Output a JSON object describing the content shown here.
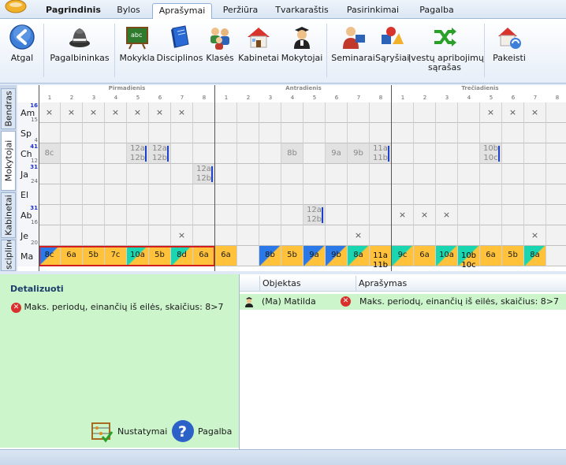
{
  "menu": {
    "tabs": [
      "Pagrindinis",
      "Bylos",
      "Aprašymai",
      "Peržiūra",
      "Tvarkaraštis",
      "Pasirinkimai",
      "Pagalba"
    ],
    "active_tab": "Aprašymai"
  },
  "ribbon": {
    "back": "Atgal",
    "pagalbininkas": "Pagalbininkas",
    "mokykla": "Mokykla",
    "disciplinos": "Disciplinos",
    "klases": "Klasės",
    "kabinetai": "Kabinetai",
    "mokytojai": "Mokytojai",
    "seminarai": "Seminarai",
    "sarysiai": "Sąryšiai",
    "apribojimai_1": "Įvestų apribojimų",
    "apribojimai_2": "sąrašas",
    "pakeisti": "Pakeisti"
  },
  "side_tabs": [
    "Bendras",
    "Mokytojai",
    "Kabinetai",
    "Disciplinos"
  ],
  "grid": {
    "days": [
      "Pirmadienis",
      "Antradienis",
      "Trečiadienis"
    ],
    "periods": [
      "1",
      "2",
      "3",
      "4",
      "5",
      "6",
      "7",
      "8"
    ],
    "rows": [
      {
        "abbr": "Am",
        "n1": "16",
        "n2": "15"
      },
      {
        "abbr": "Sp",
        "n1": "",
        "n2": "4"
      },
      {
        "abbr": "Ch",
        "n1": "41",
        "n2": "12"
      },
      {
        "abbr": "Ja",
        "n1": "31",
        "n2": "24"
      },
      {
        "abbr": "El",
        "n1": "",
        "n2": ""
      },
      {
        "abbr": "Ab",
        "n1": "31",
        "n2": "16"
      },
      {
        "abbr": "Je",
        "n1": "",
        "n2": "20"
      },
      {
        "abbr": "Ma",
        "n1": "",
        "n2": ""
      }
    ],
    "ch_cells": [
      {
        "line1": "8c",
        "line2": ""
      },
      {
        "line1": "12a",
        "line2": "12b"
      },
      {
        "line1": "12a",
        "line2": "12b"
      },
      {
        "line1": "8b",
        "line2": ""
      },
      {
        "line1": "9a",
        "line2": ""
      },
      {
        "line1": "9b",
        "line2": ""
      },
      {
        "line1": "11a",
        "line2": "11b"
      },
      {
        "line1": "10b",
        "line2": "10c"
      }
    ],
    "ja_cell": {
      "line1": "12a",
      "line2": "12b"
    },
    "ab_cell": {
      "line1": "12a",
      "line2": "12b"
    },
    "ma_lessons": [
      "8c",
      "6a",
      "5b",
      "7c",
      "10a",
      "5b",
      "8d",
      "6a",
      "6a",
      "8b",
      "5b",
      "9a",
      "9b",
      "8a",
      "11a",
      "11b",
      "9c",
      "6a",
      "10a",
      "10b",
      "10c",
      "6a",
      "5b",
      "8a"
    ]
  },
  "detail": {
    "title": "Detalizuoti",
    "error": "Maks. periodų, einančių iš eilės, skaičius: 8>7",
    "settings": "Nustatymai",
    "help": "Pagalba"
  },
  "table": {
    "col_object": "Objektas",
    "col_desc": "Aprašymas",
    "row_object": "(Ma) Matilda",
    "row_desc": "Maks. periodų, einančių iš eilės, skaičius: 8>7"
  },
  "colors": {
    "orange": "#ffc23a",
    "blue": "#2b79e8",
    "teal": "#19d6b0",
    "green_pane": "#ccf5cc",
    "error_red": "#d9302c"
  }
}
